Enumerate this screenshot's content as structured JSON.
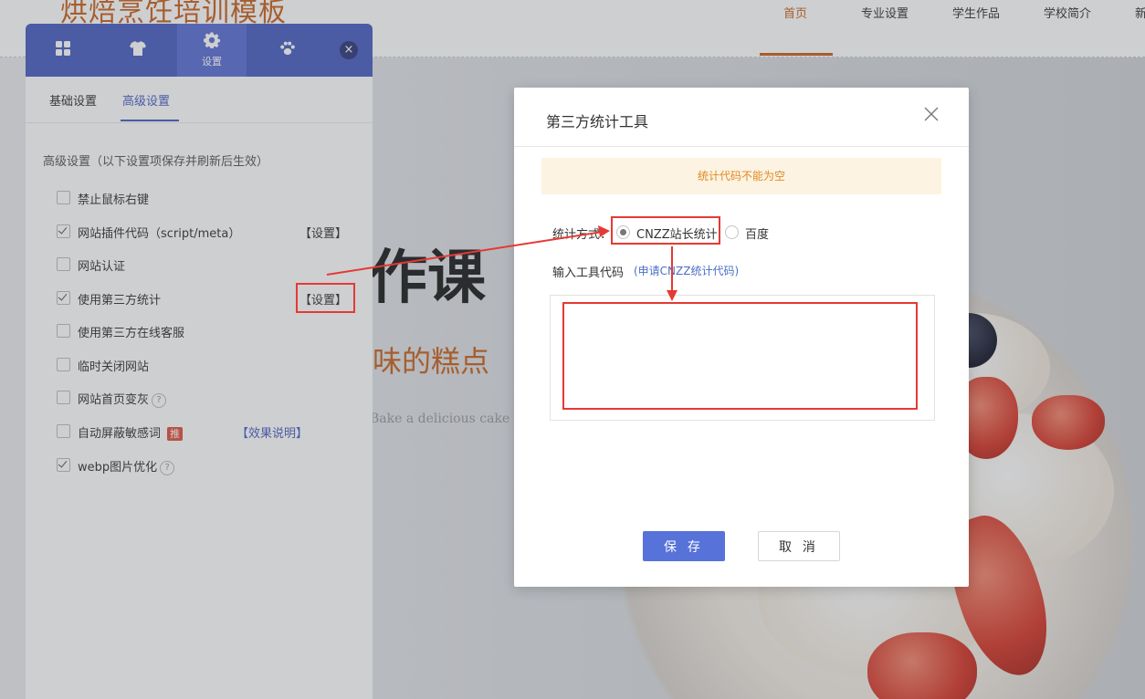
{
  "site": {
    "logo": "烘焙烹饪培训模板",
    "nav": [
      "首页",
      "专业设置",
      "学生作品",
      "学校简介",
      "新"
    ],
    "active_nav": "首页",
    "hero_title": "作课",
    "hero_subtitle": "味的糕点",
    "hero_english": "Bake a delicious cake"
  },
  "panel": {
    "header_icons": [
      {
        "icon": "grid-icon",
        "label": ""
      },
      {
        "icon": "shirt-icon",
        "label": ""
      },
      {
        "icon": "gear-icon",
        "label": "设置"
      },
      {
        "icon": "paw-icon",
        "label": ""
      }
    ],
    "close_glyph": "×",
    "tabs": [
      "基础设置",
      "高级设置"
    ],
    "active_tab": "高级设置",
    "section_title": "高级设置（以下设置项保存并刷新后生效）",
    "options": [
      {
        "label": "禁止鼠标右键",
        "checked": false
      },
      {
        "label": "网站插件代码（script/meta）",
        "checked": true,
        "action": "【设置】"
      },
      {
        "label": "网站认证",
        "checked": false
      },
      {
        "label": "使用第三方统计",
        "checked": true,
        "action": "【设置】"
      },
      {
        "label": "使用第三方在线客服",
        "checked": false
      },
      {
        "label": "临时关闭网站",
        "checked": false
      },
      {
        "label": "网站首页变灰",
        "checked": false,
        "help": "?"
      },
      {
        "label": "自动屏蔽敏感词",
        "checked": false,
        "tag": "推",
        "link": "【效果说明】"
      },
      {
        "label": "webp图片优化",
        "checked": true,
        "help": "?"
      }
    ]
  },
  "modal": {
    "title": "第三方统计工具",
    "alert": "统计代码不能为空",
    "method_label": "统计方式：",
    "methods": [
      {
        "label": "CNZZ站长统计",
        "selected": true
      },
      {
        "label": "百度",
        "selected": false
      }
    ],
    "code_label": "输入工具代码",
    "apply_link": "(申请CNZZ统计代码)",
    "code_value": "",
    "save": "保 存",
    "cancel": "取 消"
  },
  "colors": {
    "accent": "#4a5fc1",
    "brand_orange": "#c8631e",
    "highlight_red": "#e53935",
    "alert_bg": "#fdf3e2",
    "alert_text": "#e08a22"
  }
}
